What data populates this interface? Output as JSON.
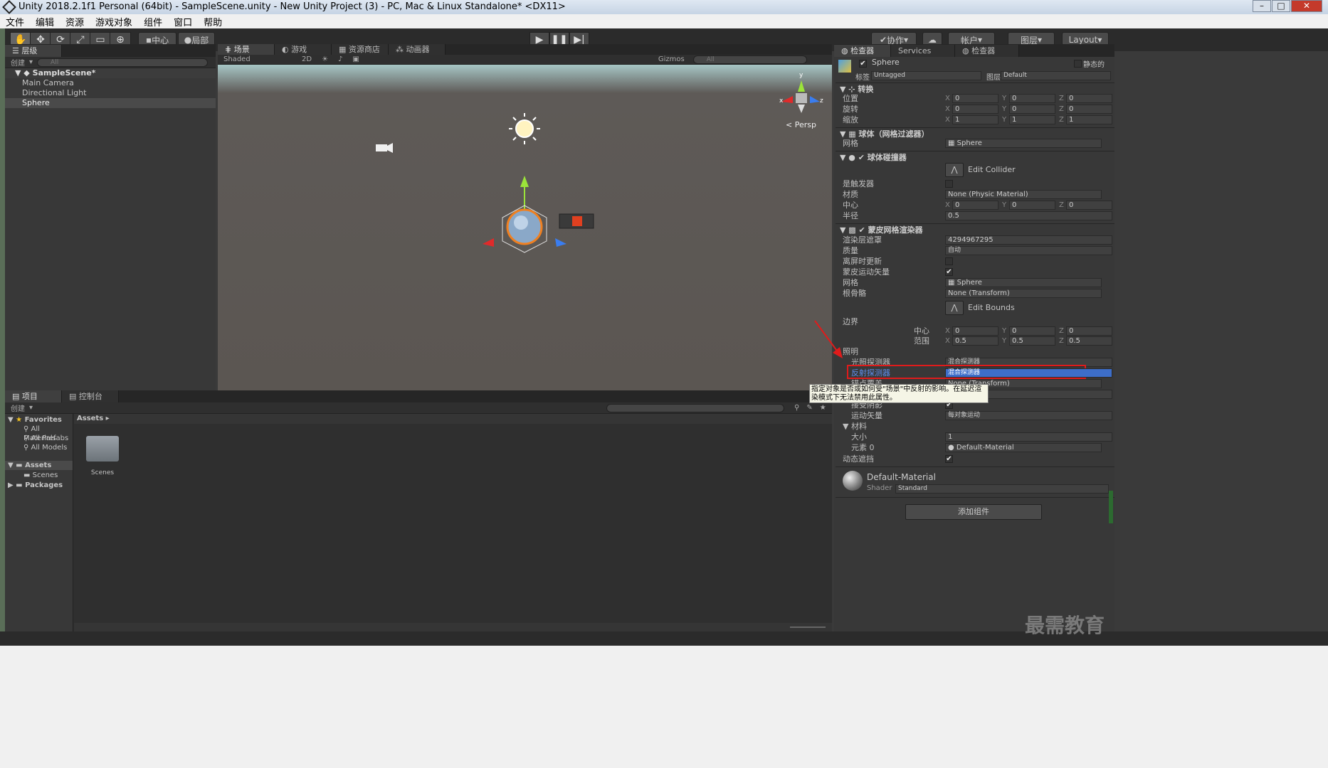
{
  "window": {
    "title": "Unity 2018.2.1f1 Personal (64bit) - SampleScene.unity - New Unity Project (3) - PC, Mac & Linux Standalone* <DX11>"
  },
  "menu": [
    "文件",
    "编辑",
    "资源",
    "游戏对象",
    "组件",
    "窗口",
    "帮助"
  ],
  "toolbar": {
    "pivot": "中心",
    "local": "局部",
    "collab": "协作",
    "account": "帐户",
    "layers": "图层",
    "layout": "Layout"
  },
  "hierarchy": {
    "tab": "层级",
    "create": "创建",
    "search_placeholder": "All",
    "scene": "SampleScene*",
    "items": [
      "Main Camera",
      "Directional Light",
      "Sphere"
    ]
  },
  "scene": {
    "tabs": [
      "场景",
      "游戏",
      "资源商店",
      "动画器"
    ],
    "shading": "Shaded",
    "mode_2d": "2D",
    "gizmos": "Gizmos",
    "search_placeholder": "All",
    "persp": "< Persp",
    "gizmo_axes": {
      "x": "x",
      "y": "y",
      "z": "z"
    }
  },
  "inspector": {
    "tabs": [
      "检查器",
      "Services",
      "检查器"
    ],
    "object_name": "Sphere",
    "static": "静态的",
    "tag_label": "标签",
    "tag": "Untagged",
    "layer_label": "图层",
    "layer": "Default",
    "transform": {
      "title": "转换",
      "rows": [
        {
          "label": "位置",
          "x": "0",
          "y": "0",
          "z": "0"
        },
        {
          "label": "旋转",
          "x": "0",
          "y": "0",
          "z": "0"
        },
        {
          "label": "缩放",
          "x": "1",
          "y": "1",
          "z": "1"
        }
      ]
    },
    "mesh_filter": {
      "title": "球体（网格过滤器）",
      "mesh_label": "网格",
      "mesh": "Sphere"
    },
    "collider": {
      "title": "球体碰撞器",
      "edit": "Edit Collider",
      "is_trigger": "是触发器",
      "material_label": "材质",
      "material": "None (Physic Material)",
      "center_label": "中心",
      "center": {
        "x": "0",
        "y": "0",
        "z": "0"
      },
      "radius_label": "半径",
      "radius": "0.5"
    },
    "renderer": {
      "title": "蒙皮网格渲染器",
      "rows": [
        {
          "label": "渲染层遮罩",
          "value": "4294967295"
        },
        {
          "label": "质量",
          "value": "自动"
        },
        {
          "label": "离屏时更新",
          "value": ""
        },
        {
          "label": "蒙皮运动矢量",
          "value": ""
        },
        {
          "label": "网格",
          "value": "Sphere"
        },
        {
          "label": "根骨骼",
          "value": "None (Transform)"
        }
      ],
      "edit_bounds": "Edit Bounds",
      "bounds_label": "边界",
      "center_label": "中心",
      "center": {
        "x": "0",
        "y": "0",
        "z": "0"
      },
      "extent_label": "范围",
      "extent": {
        "x": "0.5",
        "y": "0.5",
        "z": "0.5"
      },
      "lighting_label": "照明",
      "light_probes_label": "光照探测器",
      "light_probes": "混合探测器",
      "reflection_label": "反射探测器",
      "reflection": "混合探测器",
      "anchor_label": "锚点覆盖",
      "anchor": "None (Transform)",
      "tooltip": "指定对象是否或如何受\"场景\"中反射的影响。在延迟渲染模式下无法禁用此属性。",
      "receive_shadows": "接受阴影",
      "motion_label": "运动矢量",
      "motion": "每对象运动",
      "materials_label": "材料",
      "size_label": "大小",
      "size": "1",
      "element_label": "元素 0",
      "element": "Default-Material",
      "dynamic_label": "动态遮挡"
    },
    "material": {
      "name": "Default-Material",
      "shader_label": "Shader",
      "shader": "Standard"
    },
    "add_component": "添加组件"
  },
  "project": {
    "tabs": [
      "项目",
      "控制台"
    ],
    "create": "创建",
    "favorites": "Favorites",
    "fav_items": [
      "All Materials",
      "All Prefabs",
      "All Models"
    ],
    "assets": "Assets",
    "asset_items": [
      "Scenes"
    ],
    "packages": "Packages",
    "breadcrumb": "Assets ▸",
    "folder": "Scenes"
  },
  "watermark": "最需教育",
  "colors": {
    "highlight": "#e01b1b",
    "selection": "#3d6ec9",
    "scene_top": "#a7c6c5",
    "scene_ground": "#5b5652"
  }
}
